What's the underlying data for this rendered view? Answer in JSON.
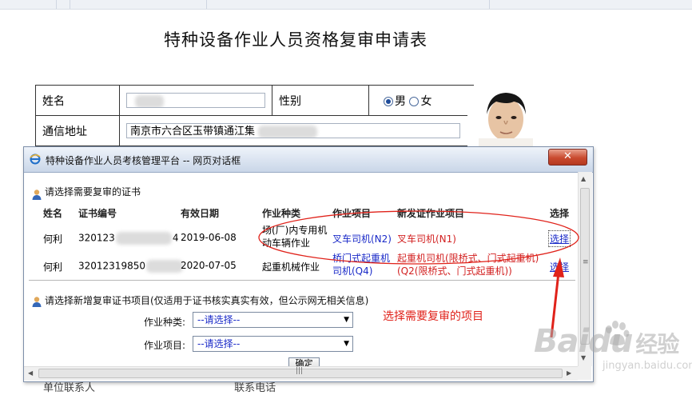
{
  "page": {
    "title": "特种设备作业人员资格复审申请表"
  },
  "form": {
    "name_label": "姓名",
    "gender_label": "性别",
    "gender_options": [
      "男",
      "女"
    ],
    "gender_selected": "男",
    "address_label": "通信地址",
    "address_value": "南京市六合区玉带镇通江集",
    "bottom_label": "单位联系人",
    "bottom_label2": "联系电话"
  },
  "dialog": {
    "title": "特种设备作业人员考核管理平台 -- 网页对话框",
    "close_label": "✕",
    "section1_label": "请选择需要复审的证书",
    "columns": [
      "姓名",
      "证书编号",
      "有效日期",
      "作业种类",
      "作业项目",
      "新发证作业项目",
      "选择"
    ],
    "rows": [
      {
        "name": "何利",
        "cert_prefix": "320123",
        "cert_suffix": "4",
        "valid_date": "2019-06-08",
        "category": "场(厂)内专用机动车辆作业",
        "item": "叉车司机(N2)",
        "new_item": "叉车司机(N1)",
        "select": "选择"
      },
      {
        "name": "何利",
        "cert_prefix": "32012319850",
        "cert_suffix": "",
        "valid_date": "2020-07-05",
        "category": "起重机械作业",
        "item": "桥门式起重机司机(Q4)",
        "new_item": "起重机司机(限桥式、门式起重机)(Q2(限桥式、门式起重机))",
        "select": "选择"
      }
    ],
    "section2_label": "请选择新增复审证书项目(仅适用于证书核实真实有效，但公示网无相关信息)",
    "category_label": "作业种类:",
    "category_value": "--请选择--",
    "item_label": "作业项目:",
    "item_value": "--请选择--",
    "ok_label": "确定"
  },
  "annotation": {
    "text": "选择需要复审的项目",
    "color": "#e0221a"
  },
  "watermark": {
    "brand": "Baidu",
    "brand_cn": "经验",
    "url": "jingyan.baidu.com"
  },
  "colors": {
    "link_blue": "#1a2ac8",
    "red": "#d21f1f",
    "titlebar": "#c9d6e8"
  }
}
